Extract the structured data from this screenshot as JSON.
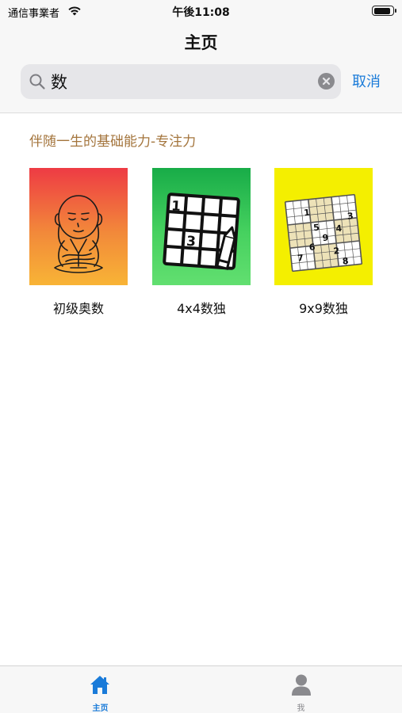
{
  "status_bar": {
    "carrier": "通信事業者",
    "time": "午後11:08",
    "battery_level": 0.95
  },
  "nav": {
    "title": "主页",
    "search": {
      "value": "数",
      "clear_icon": "clear-icon",
      "cancel_label": "取消"
    }
  },
  "section": {
    "heading": "伴随一生的基础能力-专注力"
  },
  "results": [
    {
      "label": "初级奥数",
      "icon": "meditating-monk-icon"
    },
    {
      "label": "4x4数独",
      "icon": "sudoku-4x4-icon"
    },
    {
      "label": "9x9数独",
      "icon": "sudoku-9x9-icon"
    }
  ],
  "thumb_4x4_digits": [
    "1",
    "3"
  ],
  "thumb_9x9_digits": [
    "1",
    "3",
    "5",
    "4",
    "9",
    "6",
    "2",
    "7",
    "8"
  ],
  "tabs": [
    {
      "label": "主页",
      "icon": "home-icon",
      "active": true
    },
    {
      "label": "我",
      "icon": "person-icon",
      "active": false
    }
  ],
  "colors": {
    "accent": "#1a7bd9",
    "heading": "#a4753d",
    "thumb_math": "#f2893a",
    "thumb_4x4": "#46d15f",
    "thumb_9x9": "#f4ef00"
  }
}
